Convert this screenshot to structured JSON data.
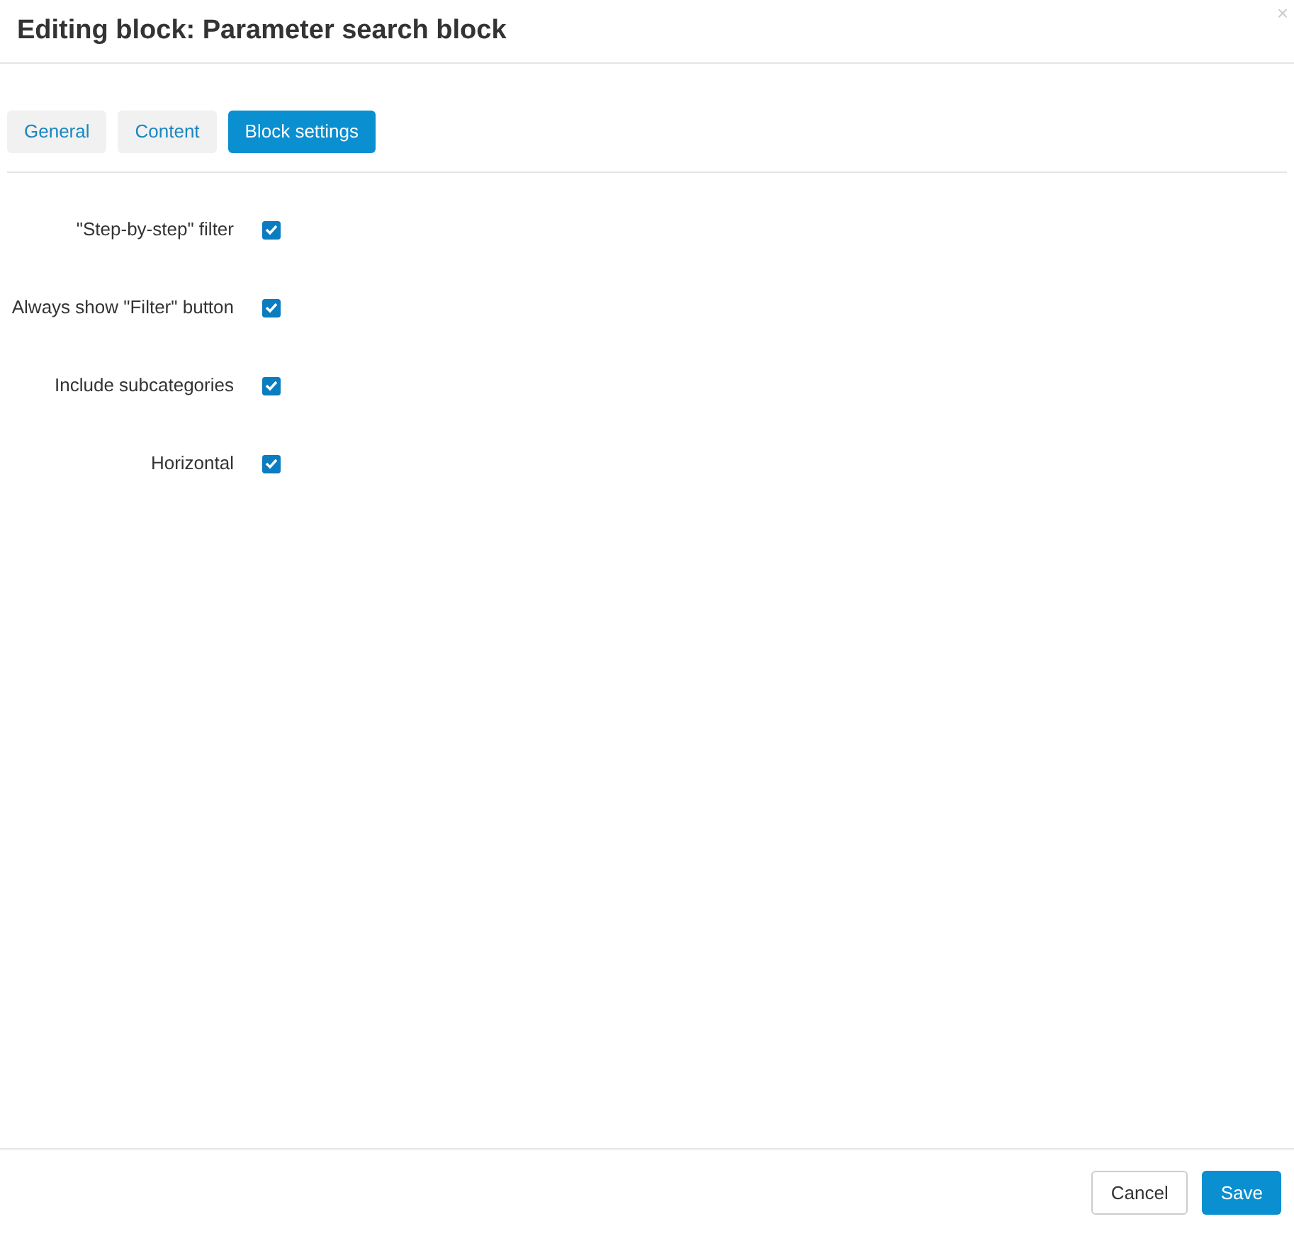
{
  "dialog": {
    "title": "Editing block: Parameter search block",
    "close": "×"
  },
  "tabs": [
    {
      "label": "General",
      "selected": false
    },
    {
      "label": "Content",
      "selected": false
    },
    {
      "label": "Block settings",
      "selected": true
    }
  ],
  "settings": [
    {
      "label": "\"Step-by-step\" filter",
      "checked": true
    },
    {
      "label": "Always show \"Filter\" button",
      "checked": true
    },
    {
      "label": "Include subcategories",
      "checked": true
    },
    {
      "label": "Horizontal",
      "checked": true
    }
  ],
  "buttons": [
    {
      "label": "Cancel",
      "kind": "secondary"
    },
    {
      "label": "Save",
      "kind": "primary"
    }
  ]
}
